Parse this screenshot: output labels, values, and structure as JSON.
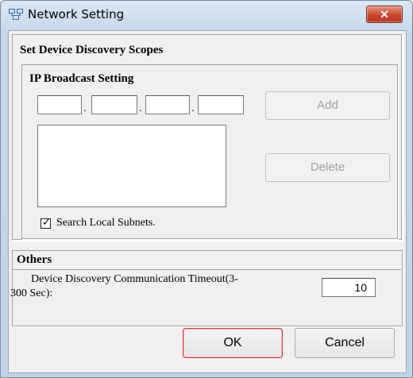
{
  "window": {
    "title": "Network Setting",
    "close_symbol": "✕"
  },
  "discovery": {
    "heading": "Set Device Discovery Scopes",
    "ip_broadcast": {
      "heading": "IP Broadcast Setting",
      "octets": [
        "",
        "",
        "",
        ""
      ],
      "separator": ".",
      "list_items": []
    },
    "add_label": "Add",
    "delete_label": "Delete",
    "search_local_subnets": {
      "label": "Search Local Subnets.",
      "checked": true,
      "mark": "✓"
    }
  },
  "others": {
    "heading": "Others",
    "timeout_label_line1": "Device Discovery Communication Timeout(3-",
    "timeout_label_line2": "300 Sec):",
    "timeout_value": "10"
  },
  "footer": {
    "ok_label": "OK",
    "cancel_label": "Cancel"
  },
  "icons": {
    "app": "network-setting-icon",
    "close": "close-icon",
    "checkbox": "checkmark-icon"
  }
}
